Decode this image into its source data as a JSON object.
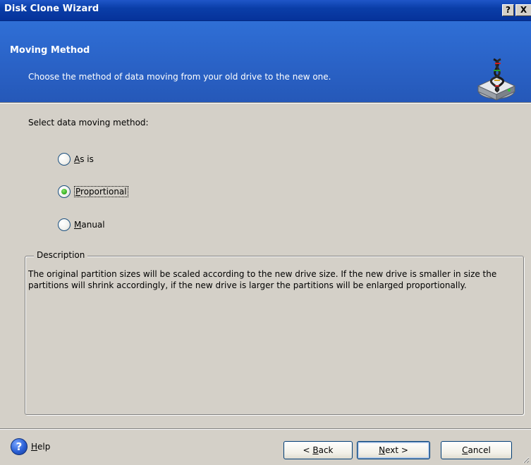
{
  "window": {
    "title": "Disk Clone Wizard"
  },
  "titlebar": {
    "help_label": "?",
    "close_label": "X"
  },
  "header": {
    "title": "Moving Method",
    "subtitle": "Choose the method of data moving from your old drive to the new one.",
    "icon": "disk-clone-icon"
  },
  "main": {
    "select_label": "Select data moving method:",
    "options": [
      {
        "label": "As is",
        "accel": "A",
        "rest": "s is",
        "checked": false
      },
      {
        "label": "Proportional",
        "accel": "P",
        "rest": "roportional",
        "checked": true
      },
      {
        "label": "Manual",
        "accel": "M",
        "rest": "anual",
        "checked": false
      }
    ],
    "description": {
      "title": "Description",
      "text": "The original partition sizes will be scaled according to the new drive size. If the new drive is smaller in size the partitions will shrink accordingly, if the new drive is larger the partitions will be enlarged proportionally."
    }
  },
  "footer": {
    "help": {
      "accel": "H",
      "rest": "elp",
      "icon": "help-icon"
    },
    "back": {
      "prefix": "< ",
      "accel": "B",
      "rest": "ack"
    },
    "next": {
      "accel": "N",
      "rest": "ext",
      "suffix": " >"
    },
    "cancel": {
      "accel": "C",
      "rest": "ancel"
    }
  },
  "colors": {
    "titlebar": "#0a3ea8",
    "header": "#2a62c6",
    "face": "#d4d0c8",
    "radio_checked": "#3fb92a"
  }
}
